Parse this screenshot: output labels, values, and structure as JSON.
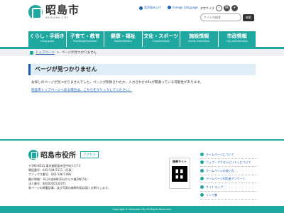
{
  "header": {
    "logo_jp": "昭島市",
    "logo_en": "AKISHIMA CITY",
    "util_links": [
      {
        "label": "音声読み上げ"
      },
      {
        "label": "Foreign Language"
      }
    ],
    "fontsize_label": "文字サイズ",
    "fontsize_small": "-",
    "fontsize_standard": "標",
    "fontsize_large": "+",
    "search_placeholder": "サイト内検索",
    "search_button": "検索"
  },
  "nav": [
    {
      "jp": "くらし・手続き",
      "en": "Living guide"
    },
    {
      "jp": "子育て・教育",
      "en": "Parenting&Education"
    },
    {
      "jp": "健康・福祉",
      "en": "Health&Welfare"
    },
    {
      "jp": "文化・スポーツ",
      "en": "Culture&Sports"
    },
    {
      "jp": "施設情報",
      "en": "Facility information"
    },
    {
      "jp": "市政情報",
      "en": "City administration"
    }
  ],
  "breadcrumb": {
    "home": "トップページ",
    "current": "ページが見つかりません"
  },
  "main": {
    "title": "ページが見つかりません",
    "message": "お探しのページが見つかりませんでした。ページが削除されたか、入力されたURLが間違っている可能性があります。",
    "top_link": "昭島市トップページへ戻る場合は、こちらをクリックしてください。"
  },
  "footer": {
    "name": "昭島市役所",
    "access": "アクセス",
    "info": [
      "〒196-8511 東京都昭島市田中町1-17-1",
      "電話番号：042-544-5111（代表）",
      "ファックス番号：042-546-5496",
      "開庁時間：平日午前8時30分から午後5時15分",
      "法人番号：8000020132071",
      "各ページの掲載記事、及び写真の無断利用は固くお断りします。"
    ],
    "qr_label": "携帯サイト",
    "links": [
      {
        "label": "ホームページについて"
      },
      {
        "label": "ウェブ・アクセシビリティについて"
      },
      {
        "label": "ホームページの使い方"
      },
      {
        "label": "ホームページ利用者アンケート"
      },
      {
        "label": "サイトマップ"
      },
      {
        "label": "リンク集"
      }
    ],
    "copyright": "Copyright © Akishima City All Rights Reserved."
  },
  "colors": {
    "teal": "#1fa8a0",
    "link_blue": "#1a5bb0",
    "title_bg": "#dfeef6"
  }
}
